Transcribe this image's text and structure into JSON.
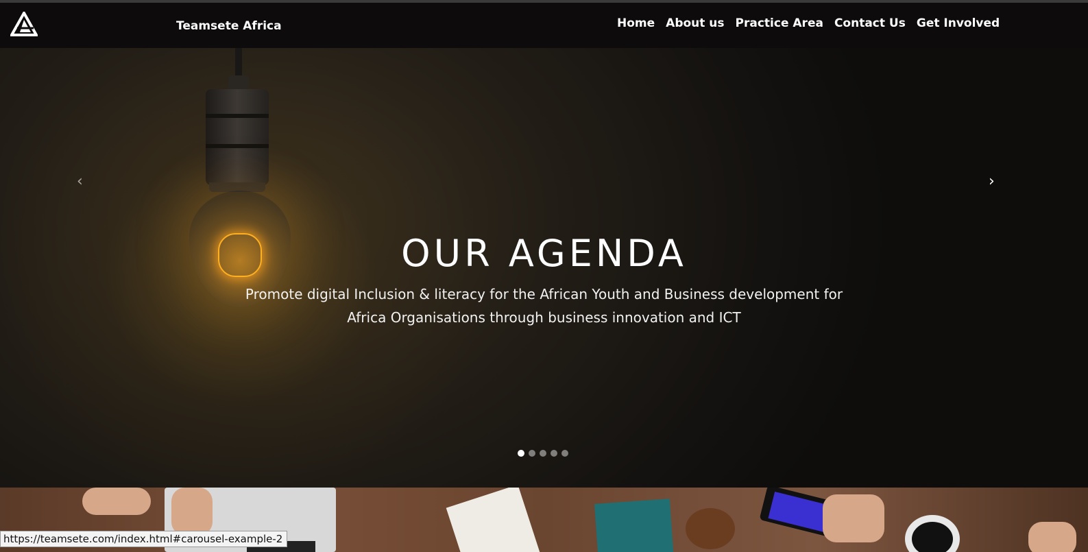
{
  "navbar": {
    "logo_icon": "triangle-a-logo-icon",
    "brand": "Teamsete Africa",
    "links": [
      {
        "label": "Home"
      },
      {
        "label": "About us"
      },
      {
        "label": "Practice Area"
      },
      {
        "label": "Contact Us"
      },
      {
        "label": "Get Involved"
      }
    ]
  },
  "carousel": {
    "prev_icon": "chevron-left-icon",
    "next_icon": "chevron-right-icon",
    "prev_glyph": "‹",
    "next_glyph": "›",
    "title": "OUR AGENDA",
    "subtitle": "Promote digital Inclusion & literacy for the African Youth and Business development for Africa Organisations through business innovation and ICT",
    "indicator_count": 5,
    "active_indicator": 0
  },
  "status_bar": {
    "url": "https://teamsete.com/index.html#carousel-example-2"
  },
  "colors": {
    "navbar_bg": "#0d0b0b",
    "text": "#ffffff"
  }
}
